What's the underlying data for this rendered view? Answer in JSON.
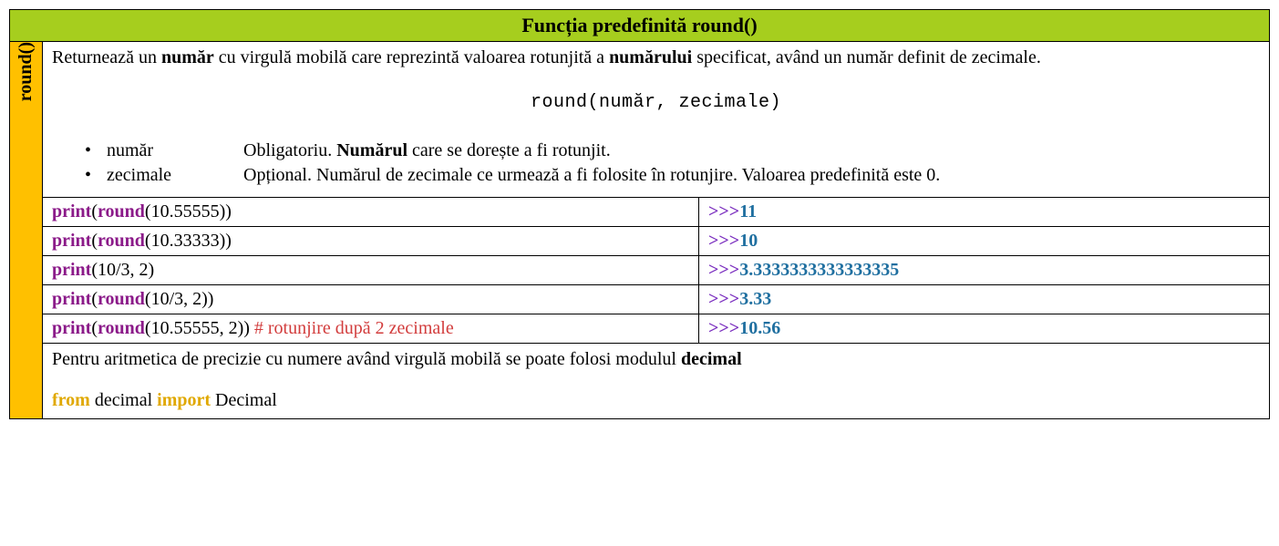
{
  "header": {
    "title": "Funcția predefinită round()"
  },
  "side": {
    "label": "round()"
  },
  "intro": {
    "pre": "Returnează un ",
    "b1": "număr",
    "mid": " cu virgulă mobilă care reprezintă valoarea rotunjită a ",
    "b2": "numărului",
    "post": " specificat, având un număr definit de zecimale."
  },
  "syntax": "round(număr, zecimale)",
  "params": [
    {
      "term": "număr",
      "desc_pre": "Obligatoriu. ",
      "desc_b": "Numărul",
      "desc_post": " care se dorește a fi rotunjit."
    },
    {
      "term": "zecimale",
      "desc_pre": "Opțional. Numărul de zecimale ce urmează a fi folosite în rotunjire. Valoarea predefinită este 0.",
      "desc_b": "",
      "desc_post": ""
    }
  ],
  "rows": [
    {
      "kw1": "print",
      "p1": "(",
      "kw2": "round",
      "p2": "(10.55555))",
      "comment": "",
      "prompt": ">>>",
      "out": "11"
    },
    {
      "kw1": "print",
      "p1": "(",
      "kw2": "round",
      "p2": "(10.33333))",
      "comment": "",
      "prompt": ">>>",
      "out": "10"
    },
    {
      "kw1": "print",
      "p1": "(10/3, 2)",
      "kw2": "",
      "p2": "",
      "comment": "",
      "prompt": ">>>",
      "out": "3.3333333333333335"
    },
    {
      "kw1": "print",
      "p1": "(",
      "kw2": "round",
      "p2": "(10/3, 2))",
      "comment": "",
      "prompt": ">>>",
      "out": "3.33"
    },
    {
      "kw1": "print",
      "p1": "(",
      "kw2": "round",
      "p2": "(10.55555, 2))",
      "comment": "     # rotunjire după 2 zecimale",
      "prompt": ">>>",
      "out": "10.56"
    }
  ],
  "footer": {
    "line_pre": "Pentru aritmetica de precizie cu numere având virgulă mobilă se poate folosi modulul ",
    "line_b": "decimal",
    "from": "from",
    "mod": " decimal ",
    "import": "import",
    "cls": " Decimal"
  }
}
